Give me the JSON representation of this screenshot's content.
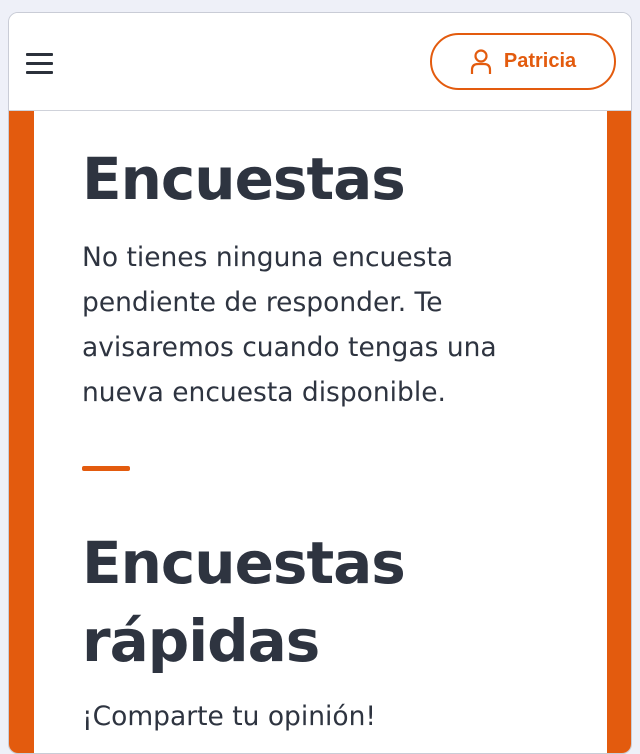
{
  "header": {
    "user_name": "Patricia"
  },
  "sections": {
    "surveys": {
      "title": "Encuestas",
      "message": "No tienes ninguna encuesta pendiente de responder. Te avisaremos cuando tengas una nueva encuesta disponible."
    },
    "quick_surveys": {
      "title_line1": "Encuestas",
      "title_line2": "rápidas",
      "subtitle": "¡Comparte tu opinión!"
    }
  },
  "colors": {
    "accent": "#e35b0e",
    "text": "#2e3440",
    "background": "#ffffff"
  },
  "icons": [
    "menu-icon",
    "user-icon"
  ]
}
